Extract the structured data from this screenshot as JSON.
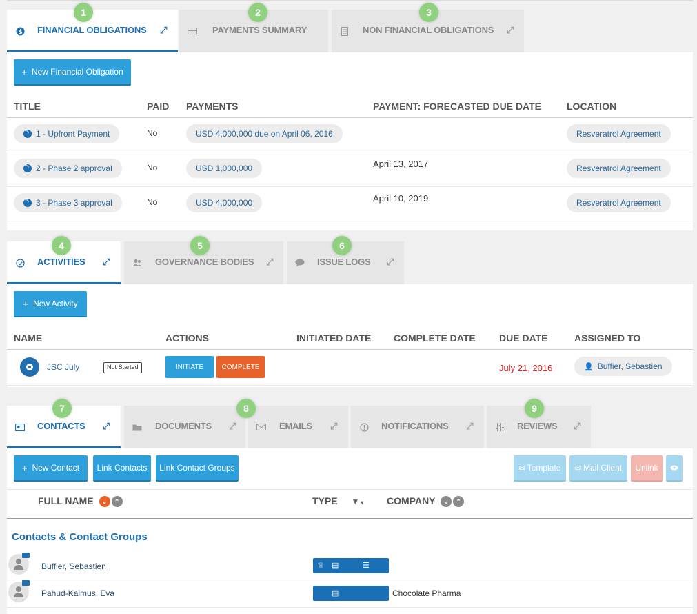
{
  "badges": [
    "1",
    "2",
    "3",
    "4",
    "5",
    "6",
    "7",
    "8",
    "9"
  ],
  "obligations": {
    "tabs": [
      {
        "label": "FINANCIAL OBLIGATIONS",
        "icon": "dollar-icon"
      },
      {
        "label": "PAYMENTS SUMMARY",
        "icon": "card-icon"
      },
      {
        "label": "NON FINANCIAL OBLIGATIONS",
        "icon": "document-icon"
      }
    ],
    "new_button": "New Financial Obligation",
    "columns": {
      "title": "TITLE",
      "paid": "PAID",
      "payments": "PAYMENTS",
      "due": "PAYMENT: FORECASTED DUE DATE",
      "location": "LOCATION"
    },
    "rows": [
      {
        "title": "1 - Upfront Payment",
        "paid": "No",
        "payments": "USD 4,000,000 due on April 06, 2016",
        "due": "",
        "location": "Resveratrol Agreement"
      },
      {
        "title": "2 - Phase 2 approval",
        "paid": "No",
        "payments": "USD 1,000,000",
        "due": "April 13, 2017",
        "location": "Resveratrol Agreement"
      },
      {
        "title": "3 - Phase 3 approval",
        "paid": "No",
        "payments": "USD 4,000,000",
        "due": "April 10, 2019",
        "location": "Resveratrol Agreement"
      }
    ]
  },
  "activities": {
    "tabs": [
      {
        "label": "ACTIVITIES",
        "icon": "check-circle-icon"
      },
      {
        "label": "GOVERNANCE BODIES",
        "icon": "group-icon"
      },
      {
        "label": "ISSUE LOGS",
        "icon": "chat-icon"
      }
    ],
    "new_button": "New Activity",
    "columns": {
      "name": "NAME",
      "actions": "ACTIONS",
      "initiated": "INITIATED DATE",
      "complete": "COMPLETE DATE",
      "due": "DUE DATE",
      "assigned": "ASSIGNED TO"
    },
    "rows": [
      {
        "name": "JSC July",
        "status": "Not Started",
        "initiate_label": "INITIATE",
        "complete_label": "COMPLETE",
        "due": "July 21, 2016",
        "assigned": "Buffier, Sebastien"
      }
    ],
    "colors": {
      "due_overdue": "#e02020",
      "initiate": "#2d9fdb",
      "complete": "#e8622c"
    }
  },
  "contacts": {
    "tabs": [
      {
        "label": "CONTACTS",
        "icon": "contact-card-icon"
      },
      {
        "label": "DOCUMENTS",
        "icon": "folder-icon"
      },
      {
        "label": "EMAILS",
        "icon": "envelope-icon"
      },
      {
        "label": "NOTIFICATIONS",
        "icon": "alert-icon"
      },
      {
        "label": "REVIEWS",
        "icon": "sliders-icon"
      }
    ],
    "buttons": {
      "new_contact": "New Contact",
      "link_contacts": "Link Contacts",
      "link_groups": "Link Contact Groups",
      "template": "Template",
      "mail_client": "Mail Client",
      "unlink": "Unlink"
    },
    "columns": {
      "full_name": "FULL NAME",
      "type": "TYPE",
      "company": "COMPANY"
    },
    "group_title": "Contacts & Contact Groups",
    "rows": [
      {
        "name": "Buffier, Sebastien",
        "company": ""
      },
      {
        "name": "Pahud-Kalmus, Eva",
        "company": "Chocolate Pharma"
      }
    ]
  }
}
